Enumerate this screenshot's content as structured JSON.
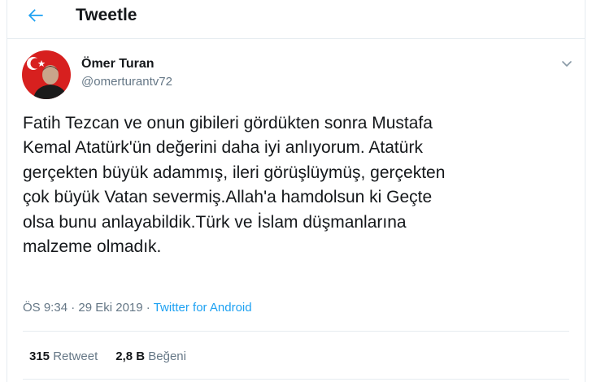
{
  "header": {
    "title": "Tweetle",
    "back_icon": "arrow-left-icon"
  },
  "author": {
    "name": "Ömer Turan",
    "handle": "@omerturantv72",
    "avatar_icon": "profile-photo"
  },
  "tweet": {
    "text": "Fatih Tezcan ve onun gibileri gördükten sonra Mustafa\nKemal Atatürk'ün değerini daha iyi anlıyorum. Atatürk\ngerçekten büyük adammış, ileri görüşlüymüş, gerçekten\nçok büyük Vatan severmiş.Allah'a hamdolsun ki Geçte\nolsa bunu anlayabildik.Türk ve İslam düşmanlarına\nmalzeme olmadık.",
    "time": "ÖS 9:34",
    "separator": "·",
    "date": "29 Eki 2019",
    "source": "Twitter for Android"
  },
  "stats": {
    "retweet_count": "315",
    "retweet_label": "Retweet",
    "like_count": "2,8 B",
    "like_label": "Beğeni"
  },
  "colors": {
    "accent": "#1da1f2",
    "text": "#14171a",
    "secondary_text": "#657786",
    "border": "#e6ecf0"
  }
}
